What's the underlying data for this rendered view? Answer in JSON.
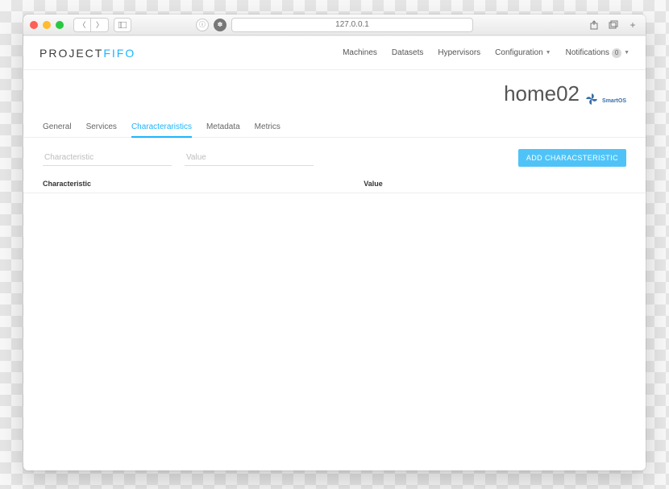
{
  "browser": {
    "address": "127.0.0.1"
  },
  "app": {
    "logo_main": "PROJECT",
    "logo_accent": "FIFO"
  },
  "nav": {
    "machines": "Machines",
    "datasets": "Datasets",
    "hypervisors": "Hypervisors",
    "configuration": "Configuration",
    "notifications": "Notifications",
    "notifications_count": "0"
  },
  "page": {
    "title": "home02",
    "os_label": "SmartOS"
  },
  "tabs": {
    "general": "General",
    "services": "Services",
    "characteristics": "Characteraristics",
    "metadata": "Metadata",
    "metrics": "Metrics"
  },
  "form": {
    "characteristic_placeholder": "Characteristic",
    "value_placeholder": "Value",
    "add_button": "ADD CHARACSTERISTIC"
  },
  "table": {
    "col_characteristic": "Characteristic",
    "col_value": "Value"
  }
}
